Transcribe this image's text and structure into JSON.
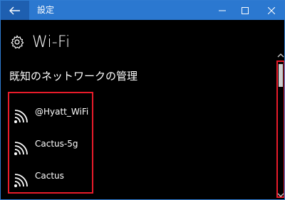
{
  "window": {
    "title": "設定",
    "controls": {
      "back_icon": "arrow-left-icon",
      "minimize_icon": "minimize-icon",
      "maximize_icon": "maximize-icon",
      "close_icon": "close-icon"
    },
    "accent_color": "#2b78d0"
  },
  "page": {
    "title": "Wi-Fi",
    "title_icon": "gear-icon",
    "section_title": "既知のネットワークの管理"
  },
  "networks": [
    {
      "name": "@Hyatt_WiFi",
      "icon": "wifi-icon"
    },
    {
      "name": "Cactus-5g",
      "icon": "wifi-icon"
    },
    {
      "name": "Cactus",
      "icon": "wifi-icon"
    }
  ],
  "highlight_color": "#e81b2a"
}
